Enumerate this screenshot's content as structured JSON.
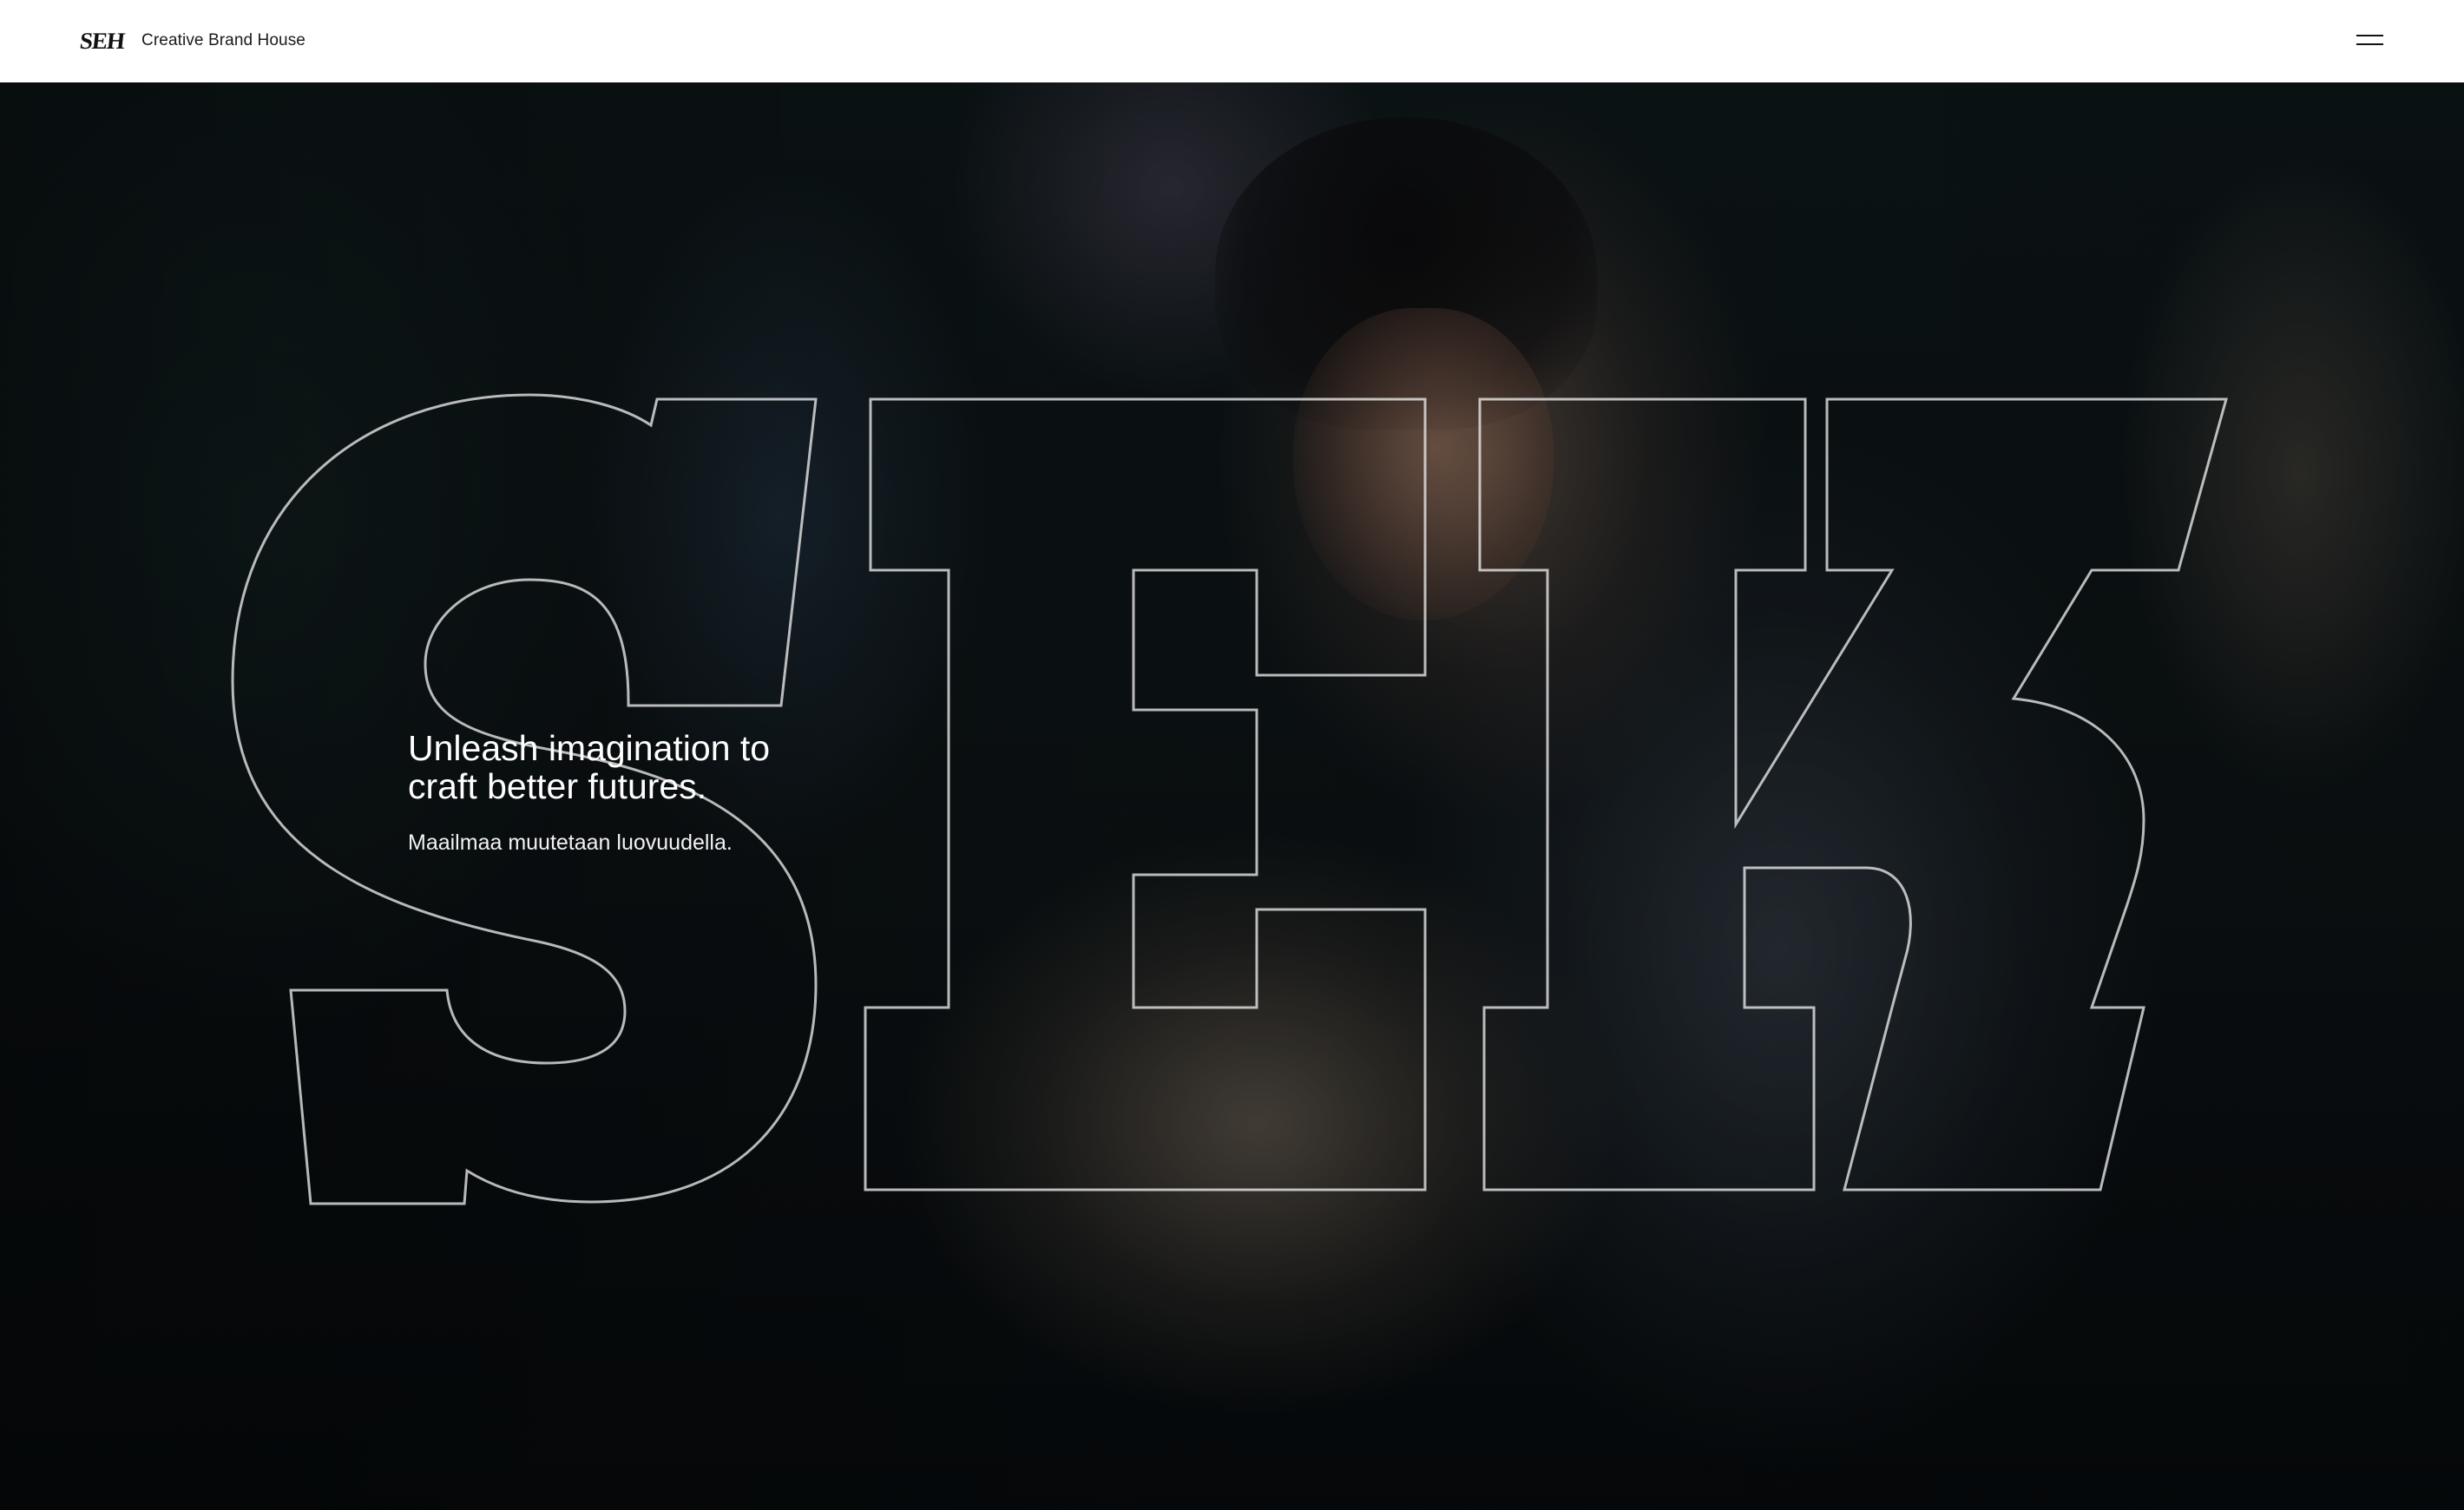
{
  "header": {
    "logo_text": "SEH",
    "brand_name": "Creative Brand House",
    "menu_icon": "hamburger-menu-icon"
  },
  "hero": {
    "background": "photo of a person wrapped in a blanket holding a small fluffy animal",
    "outline_logo_text": "SEH",
    "headline": "Unleash imagination to craft better futures.",
    "subline": "Maailmaa muutetaan luovuudella."
  },
  "colors": {
    "header_bg": "#ffffff",
    "text_on_dark": "#ffffff",
    "outline_stroke": "#ebebeb"
  }
}
